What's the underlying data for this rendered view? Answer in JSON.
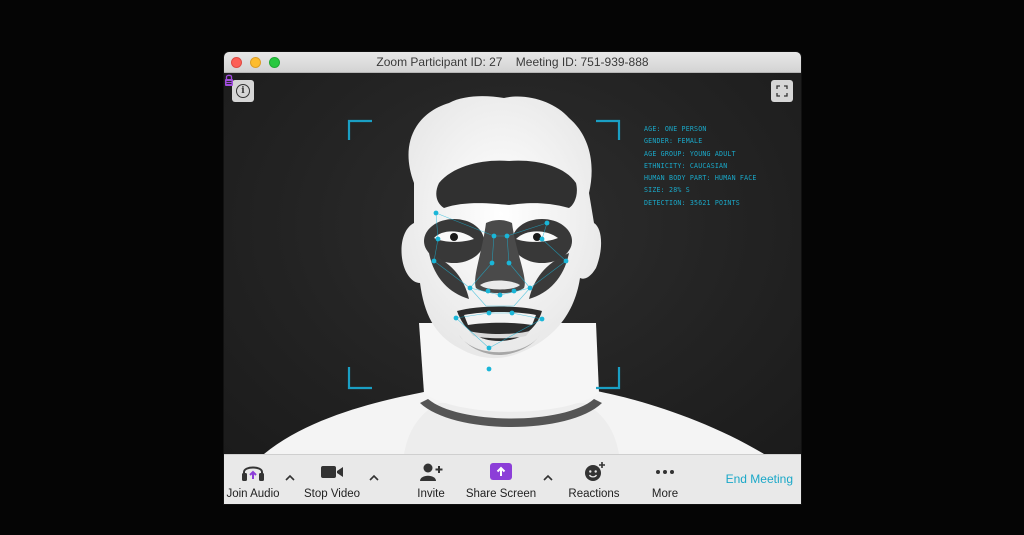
{
  "window": {
    "title": "Zoom Participant ID: 27    Meeting ID: 751-939-888"
  },
  "video": {
    "info_icon_glyph": "i",
    "overlay_lines": [
      "AGE: ONE PERSON",
      "GENDER: FEMALE",
      "AGE GROUP: YOUNG ADULT",
      "ETHNICITY: CAUCASIAN",
      "HUMAN BODY PART: HUMAN FACE",
      "SIZE: 28% S",
      "DETECTION: 35621 POINTS"
    ],
    "overlay_color": "#1aa8c8",
    "icons": {
      "info": "info-icon",
      "lock": "lock-icon",
      "fullscreen": "fullscreen-icon"
    }
  },
  "toolbar": {
    "join_audio": "Join Audio",
    "stop_video": "Stop Video",
    "invite": "Invite",
    "share_screen": "Share Screen",
    "reactions": "Reactions",
    "more": "More",
    "end_meeting": "End Meeting",
    "accent_color": "#1aa8c8",
    "share_color": "#8c3ed8"
  }
}
